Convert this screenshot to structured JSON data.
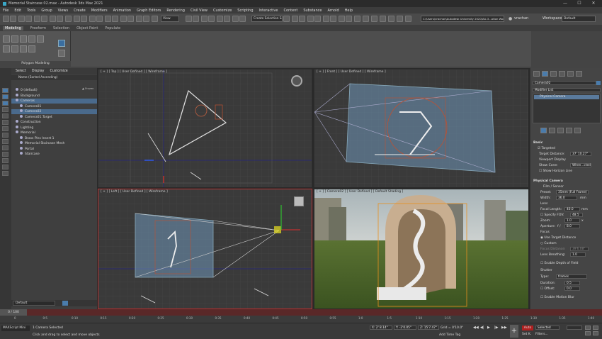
{
  "window": {
    "title": "Memorial Staircase 02.max - Autodesk 3ds Max 2021",
    "minimize": "—",
    "maximize": "☐",
    "close": "✕"
  },
  "menu": [
    "File",
    "Edit",
    "Tools",
    "Group",
    "Views",
    "Create",
    "Modifiers",
    "Animation",
    "Graph Editors",
    "Rendering",
    "Civil View",
    "Customize",
    "Scripting",
    "Interactive",
    "Content",
    "Substance",
    "Arnold",
    "Help"
  ],
  "account": {
    "user": "vrachan",
    "workspace_label": "Workspaces:",
    "workspace_value": "Default"
  },
  "toolbar": {
    "view_dropdown": "View",
    "selection_set": "Create Selection Se",
    "project_path": "C:\\Users\\vrachan\\Autodesk University 2020\\AU-3...ation Workflow Tips\\AWK03"
  },
  "ribbon": {
    "tabs": [
      "Modeling",
      "Freeform",
      "Selection",
      "Object Paint",
      "Populate"
    ],
    "active_tab": "Modeling",
    "section_label": "Polygon Modeling"
  },
  "scene_explorer": {
    "tabs": [
      "Select",
      "Display",
      "Customize"
    ],
    "header_col1": "Name (Sorted Ascending)",
    "header_col2": "▲ Frozen",
    "rows": [
      {
        "label": "0 (default)",
        "indent": 1,
        "selected": false
      },
      {
        "label": "Background",
        "indent": 1,
        "selected": false
      },
      {
        "label": "Cameras",
        "indent": 1,
        "selected": true
      },
      {
        "label": "Camera01",
        "indent": 2,
        "selected": false
      },
      {
        "label": "Camera02",
        "indent": 2,
        "selected": true
      },
      {
        "label": "Camera01.Target",
        "indent": 2,
        "selected": false
      },
      {
        "label": "Construction",
        "indent": 1,
        "selected": false
      },
      {
        "label": "Lighting",
        "indent": 1,
        "selected": false
      },
      {
        "label": "Memorial",
        "indent": 1,
        "selected": false
      },
      {
        "label": "Brass Pins Insert 1",
        "indent": 2,
        "selected": false
      },
      {
        "label": "Memorial Staircase Mesh",
        "indent": 2,
        "selected": false
      },
      {
        "label": "Portal",
        "indent": 2,
        "selected": false
      },
      {
        "label": "Staircase",
        "indent": 2,
        "selected": false
      }
    ],
    "layer_dropdown": "Default"
  },
  "viewports": {
    "top_left": "[ + ] [ Top ] [ User Defined ] [ Wireframe ]",
    "top_right": "[ + ] [ Front ] [ User Defined ] [ Wireframe ]",
    "bottom_left": "[ + ] [ Left ] [ User Defined ] [ Wireframe ]",
    "bottom_right": "[ + ] [ Camera02 ] [ User Defined ] [ Default Shading ]"
  },
  "command_panel": {
    "object_name": "Camera02",
    "modifier_list": "Modifier List",
    "stack_item": "Physical Camera",
    "rollout_basic": "Basic",
    "targeted": "Targeted",
    "target_distance_label": "Target Distance:",
    "target_distance_value": "37' 10.27\"",
    "viewport_display": "Viewport Display",
    "show_cone_label": "Show Cone:",
    "show_cone_value": "When...cted",
    "show_horizon_line": "Show Horizon Line",
    "rollout_physical": "Physical Camera",
    "film_sensor": "Film / Sensor",
    "preset_label": "Preset:",
    "preset_value": "35mm (Full Frame)",
    "width_label": "Width:",
    "width_value": "36.0",
    "width_unit": "mm",
    "lens": "Lens",
    "focal_length_label": "Focal Length:",
    "focal_length_value": "40.0",
    "focal_length_unit": "mm",
    "specify_fov": "Specify FOV:",
    "fov_value": "48.5",
    "zoom_label": "Zoom:",
    "zoom_value": "1.0",
    "zoom_unit": "x",
    "aperture_label": "Aperture:",
    "aperture_prefix": "f /",
    "aperture_value": "8.0",
    "focus": "Focus",
    "use_target_distance": "Use Target Distance",
    "custom": "Custom",
    "focus_distance_label": "Focus Distance:",
    "focus_distance_value": "39'6.08\"",
    "lens_breathing_label": "Lens Breathing:",
    "lens_breathing_value": "1.0",
    "enable_dof": "Enable Depth of Field",
    "shutter": "Shutter",
    "type_label": "Type:",
    "type_value": "frames",
    "duration_label": "Duration:",
    "duration_value": "0.5",
    "offset_label": "Offset:",
    "offset_value": "0.0",
    "enable_motion_blur": "Enable Motion Blur"
  },
  "timeline": {
    "frame_display": "0 / 100",
    "ticks": [
      "0",
      "0:5",
      "0:10",
      "0:15",
      "0:20",
      "0:25",
      "0:30",
      "0:35",
      "0:40",
      "0:45",
      "0:50",
      "0:55",
      "1:0",
      "1:5",
      "1:10",
      "1:15",
      "1:20",
      "1:25",
      "1:30",
      "1:35",
      "1:40"
    ]
  },
  "status": {
    "maxscript": "MAXScript Mini",
    "line1": "1 Camera Selected",
    "line2": "Click and drag to select and move objects",
    "x": "X: 2' 8.14\"",
    "y": "Y: -2'0.05\"",
    "z": "Z: 15'7.47\"",
    "grid": "Grid = 0'10.0\"",
    "add_time_tag": "Add Time Tag",
    "auto": "Auto",
    "selected": "Selected",
    "set_key": "Set K.",
    "filters": "Filters..."
  },
  "colors": {
    "accent_blue": "#4a8cc8",
    "timeline_red": "#8a2a2a",
    "selection_highlight": "#5a7a9c"
  }
}
